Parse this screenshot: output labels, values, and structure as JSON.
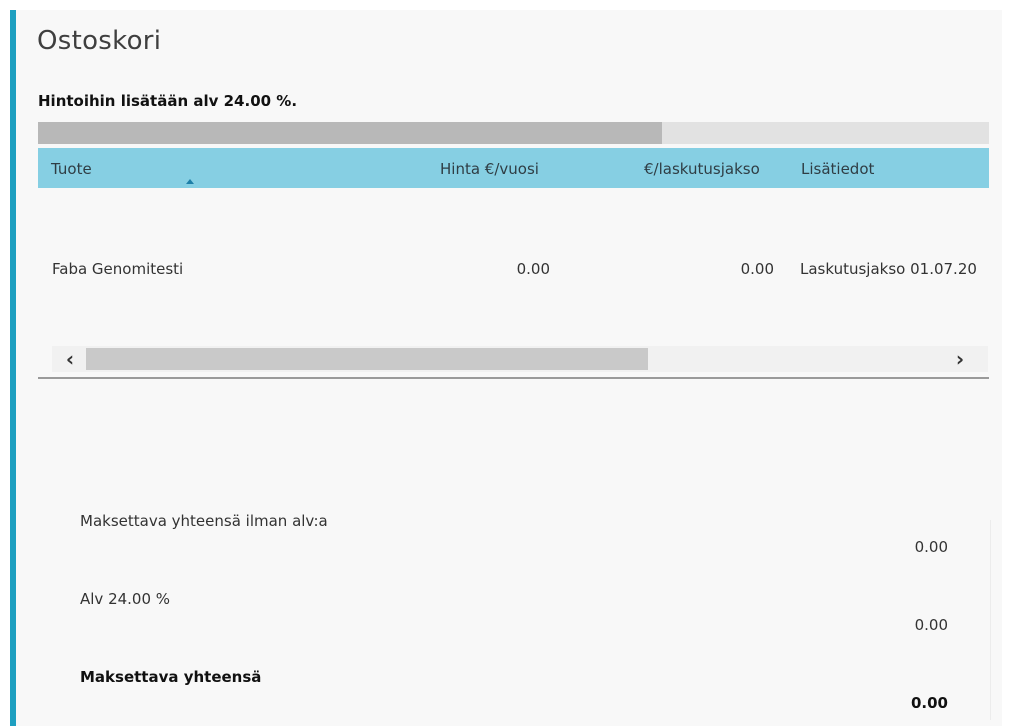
{
  "page": {
    "title": "Ostoskori",
    "vat_note": "Hintoihin lisätään alv 24.00 %."
  },
  "table": {
    "columns": {
      "product": "Tuote",
      "price_year": "Hinta €/vuosi",
      "price_period": "€/laskutusjakso",
      "info": "Lisätiedot"
    },
    "rows": [
      {
        "product": "Faba Genomitesti",
        "price_year": "0.00",
        "price_period": "0.00",
        "info": "Laskutusjakso 01.07.20"
      }
    ],
    "scroll": {
      "left_arrow": "‹",
      "right_arrow": "›"
    }
  },
  "summary": {
    "subtotal_label": "Maksettava yhteensä ilman alv:a",
    "subtotal_value": "0.00",
    "vat_label": "Alv 24.00 %",
    "vat_value": "0.00",
    "total_label": "Maksettava yhteensä",
    "total_value": "0.00"
  },
  "colors": {
    "accent": "#1e9fc0",
    "header_bg": "#86cfe3"
  },
  "icons": {
    "sort": "sort-ascending-icon",
    "scroll_left": "chevron-left-icon",
    "scroll_right": "chevron-right-icon"
  }
}
